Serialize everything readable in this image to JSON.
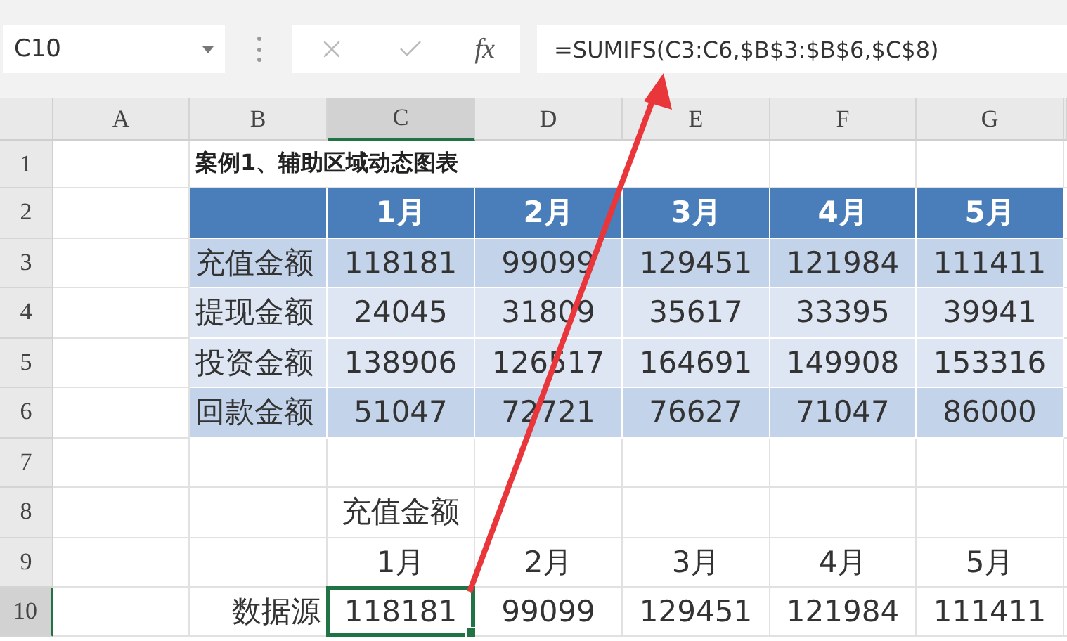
{
  "name_box": {
    "value": "C10"
  },
  "formula_bar": {
    "function_label": "fx",
    "formula": "=SUMIFS(C3:C6,$B$3:$B$6,$C$8)"
  },
  "column_headers": [
    {
      "label": "A",
      "selected": false
    },
    {
      "label": "B",
      "selected": false
    },
    {
      "label": "C",
      "selected": true
    },
    {
      "label": "D",
      "selected": false
    },
    {
      "label": "E",
      "selected": false
    },
    {
      "label": "F",
      "selected": false
    },
    {
      "label": "G",
      "selected": false
    }
  ],
  "row_headers": [
    {
      "label": "1",
      "selected": false
    },
    {
      "label": "2",
      "selected": false
    },
    {
      "label": "3",
      "selected": false
    },
    {
      "label": "4",
      "selected": false
    },
    {
      "label": "5",
      "selected": false
    },
    {
      "label": "6",
      "selected": false
    },
    {
      "label": "7",
      "selected": false
    },
    {
      "label": "8",
      "selected": false
    },
    {
      "label": "9",
      "selected": false
    },
    {
      "label": "10",
      "selected": true
    }
  ],
  "title": "案例1、辅助区域动态图表",
  "table": {
    "months": [
      "1月",
      "2月",
      "3月",
      "4月",
      "5月"
    ],
    "rows": [
      {
        "label": "充值金额",
        "highlighted": true,
        "values": [
          "118181",
          "99099",
          "129451",
          "121984",
          "111411"
        ]
      },
      {
        "label": "提现金额",
        "highlighted": false,
        "values": [
          "24045",
          "31809",
          "35617",
          "33395",
          "39941"
        ]
      },
      {
        "label": "投资金额",
        "highlighted": false,
        "values": [
          "138906",
          "126517",
          "164691",
          "149908",
          "153316"
        ]
      },
      {
        "label": "回款金额",
        "highlighted": true,
        "values": [
          "51047",
          "72721",
          "76627",
          "71047",
          "86000"
        ]
      }
    ]
  },
  "helper": {
    "category": "充值金额",
    "months": [
      "1月",
      "2月",
      "3月",
      "4月",
      "5月"
    ],
    "source_label": "数据源",
    "values": [
      {
        "text": "118181",
        "selected": true
      },
      {
        "text": "99099",
        "selected": false
      },
      {
        "text": "129451",
        "selected": false
      },
      {
        "text": "121984",
        "selected": false
      },
      {
        "text": "111411",
        "selected": false
      }
    ]
  }
}
